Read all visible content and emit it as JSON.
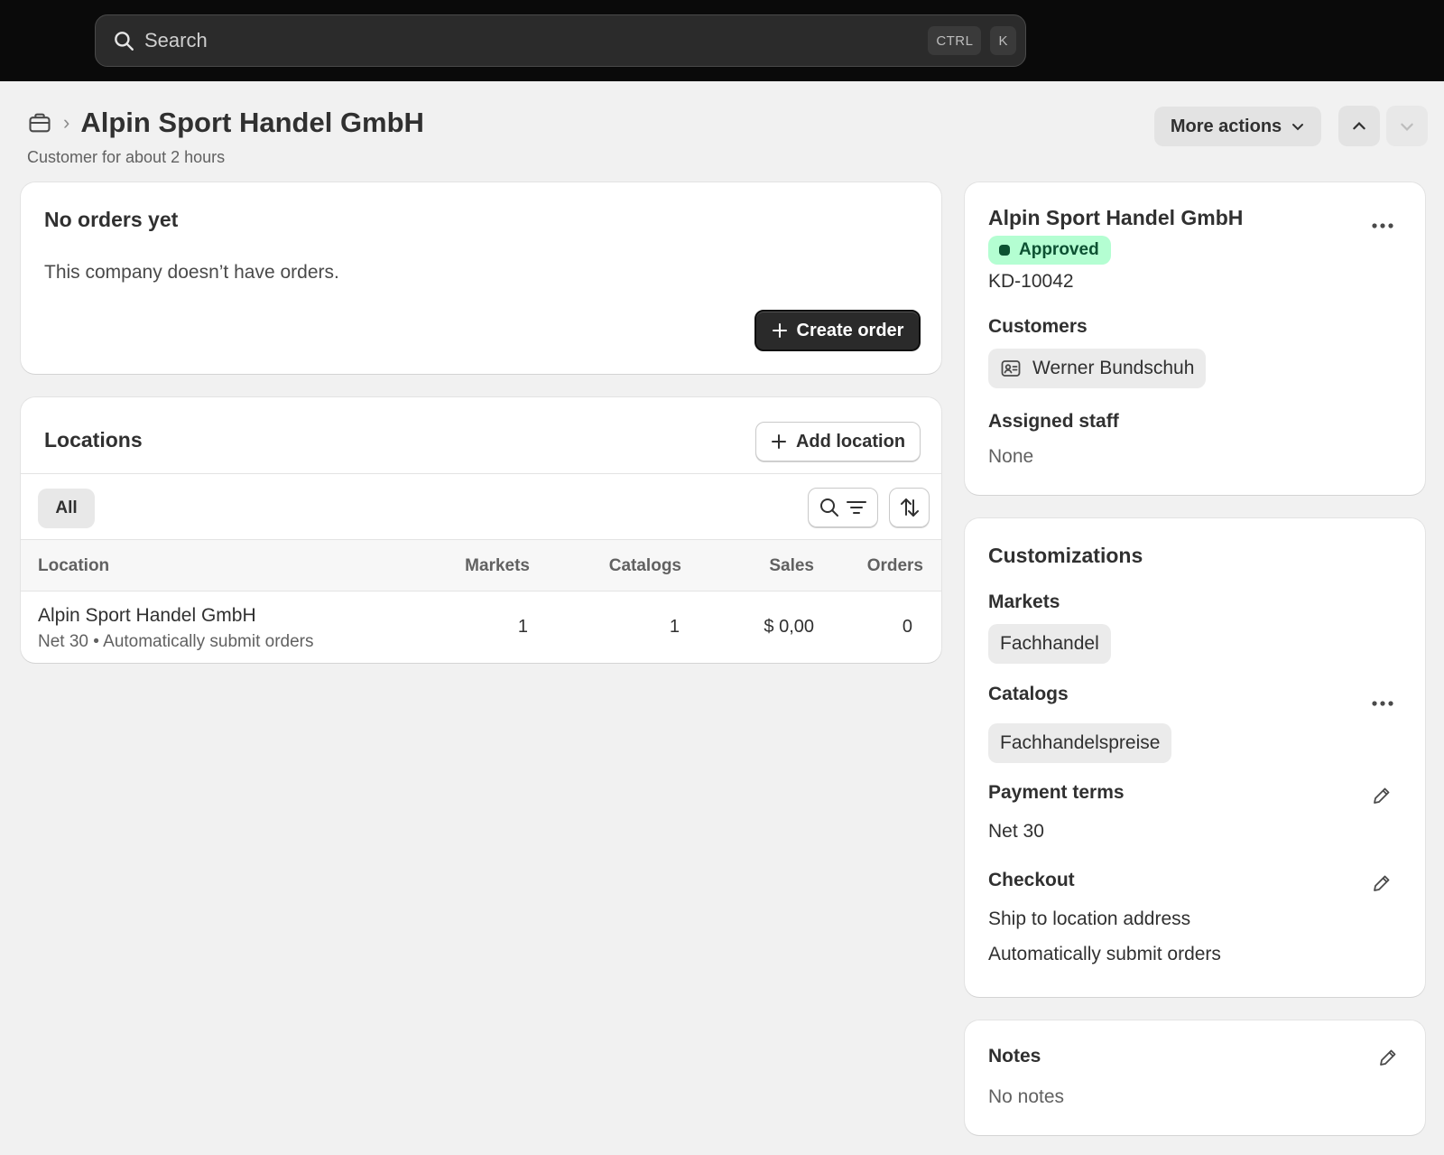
{
  "topbar": {
    "search_placeholder": "Search",
    "shortcut_ctrl": "CTRL",
    "shortcut_key": "K"
  },
  "header": {
    "title": "Alpin Sport Handel GmbH",
    "subtitle": "Customer for about 2 hours",
    "more_actions_label": "More actions"
  },
  "orders": {
    "title": "No orders yet",
    "body": "This company doesn’t have orders.",
    "create_order_label": "Create order"
  },
  "locations": {
    "title": "Locations",
    "add_location_label": "Add location",
    "tab_all": "All",
    "columns": {
      "location": "Location",
      "markets": "Markets",
      "catalogs": "Catalogs",
      "sales": "Sales",
      "orders": "Orders"
    },
    "rows": [
      {
        "name": "Alpin Sport Handel GmbH",
        "meta": "Net 30 • Automatically submit orders",
        "markets": "1",
        "catalogs": "1",
        "sales": "$ 0,00",
        "orders": "0"
      }
    ]
  },
  "company": {
    "name": "Alpin Sport Handel GmbH",
    "status": "Approved",
    "id": "KD-10042",
    "customers_heading": "Customers",
    "customer_name": "Werner Bundschuh",
    "staff_heading": "Assigned staff",
    "staff_value": "None"
  },
  "customizations": {
    "title": "Customizations",
    "markets_heading": "Markets",
    "market_chip": "Fachhandel",
    "catalogs_heading": "Catalogs",
    "catalog_chip": "Fachhandelspreise",
    "payment_heading": "Payment terms",
    "payment_value": "Net 30",
    "checkout_heading": "Checkout",
    "checkout_line1": "Ship to location address",
    "checkout_line2": "Automatically submit orders"
  },
  "notes": {
    "title": "Notes",
    "value": "No notes"
  },
  "colors": {
    "topbar_bg": "#0a0a0a",
    "page_bg": "#f1f1f1",
    "badge_bg": "#b4fed2",
    "badge_fg": "#0c5132",
    "primary_button": "#2a2a2a"
  }
}
